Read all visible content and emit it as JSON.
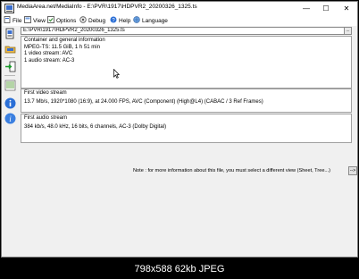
{
  "window": {
    "title": "MediaArea.net/MediaInfo - E:\\PVR\\1917\\HDPVR2_20200326_1325.ts",
    "minimize_glyph": "—",
    "maximize_glyph": "☐",
    "close_glyph": "✕"
  },
  "menu": {
    "file": "File",
    "view": "View",
    "options": "Options",
    "debug": "Debug",
    "help": "Help",
    "language": "Language"
  },
  "toolbar_icons": [
    "open-file-icon",
    "open-folder-icon",
    "export-icon",
    "sheet-view-icon",
    "info-icon",
    "about-icon"
  ],
  "file_select": {
    "value": "E:\\PVR\\1917\\HDPVR2_20200326_1325.ts",
    "arrow": "..."
  },
  "general": {
    "title": "Container and general information",
    "lines": [
      "MPEG-TS: 11.5 GiB, 1 h 51 min",
      "1 video stream: AVC",
      "1 audio stream: AC-3"
    ]
  },
  "video": {
    "title": "First video stream",
    "line": "13.7 Mb/s, 1920*1080 (16:9), at 24.000 FPS, AVC (Component) (High@L4) (CABAC / 3 Ref Frames)"
  },
  "audio": {
    "title": "First audio stream",
    "line": "384 kb/s, 48.0 kHz, 16 bits, 6 channels, AC-3 (Dolby Digital)"
  },
  "note": {
    "text": "Note : for more information about this file, you must select a different view (Sheet, Tree...)",
    "button": "-->"
  },
  "caption": "798x588  62kb  JPEG",
  "colors": {
    "accent_blue": "#1a5fb4",
    "info_blue": "#2b6fd6",
    "window_bg": "#f0f0f0"
  }
}
